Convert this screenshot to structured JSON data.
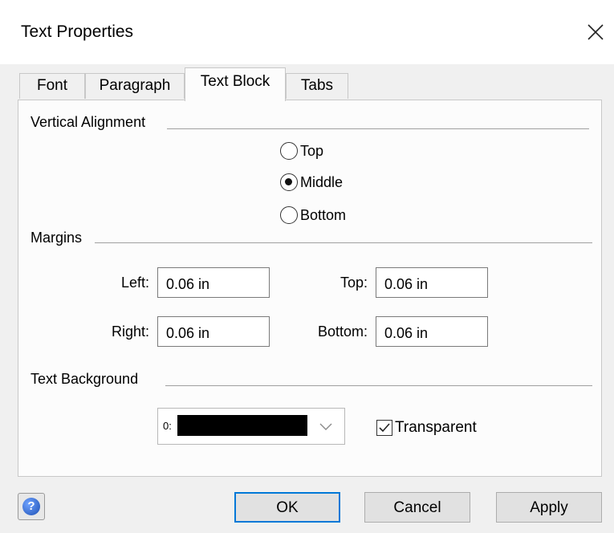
{
  "dialog": {
    "title": "Text Properties"
  },
  "tabs": [
    {
      "label": "Font"
    },
    {
      "label": "Paragraph"
    },
    {
      "label": "Text Block",
      "active": true
    },
    {
      "label": "Tabs"
    }
  ],
  "vertical_alignment": {
    "label": "Vertical Alignment",
    "options": [
      "Top",
      "Middle",
      "Bottom"
    ],
    "selected": "Middle"
  },
  "margins": {
    "label": "Margins",
    "left": {
      "label": "Left:",
      "value": "0.06 in"
    },
    "top": {
      "label": "Top:",
      "value": "0.06 in"
    },
    "right": {
      "label": "Right:",
      "value": "0.06 in"
    },
    "bottom": {
      "label": "Bottom:",
      "value": "0.06 in"
    }
  },
  "text_background": {
    "label": "Text Background",
    "color_index": "0:",
    "color": "#000000",
    "transparent_label": "Transparent",
    "transparent_checked": true
  },
  "buttons": {
    "ok": "OK",
    "cancel": "Cancel",
    "apply": "Apply"
  },
  "icons": {
    "close": "close-icon",
    "help": "help-icon",
    "dropdown": "chevron-down-icon",
    "check": "checkmark-icon"
  },
  "colors": {
    "accent": "#0078d7",
    "dialog_bg": "#f0f0f0",
    "panel_bg": "#fcfcfc"
  }
}
